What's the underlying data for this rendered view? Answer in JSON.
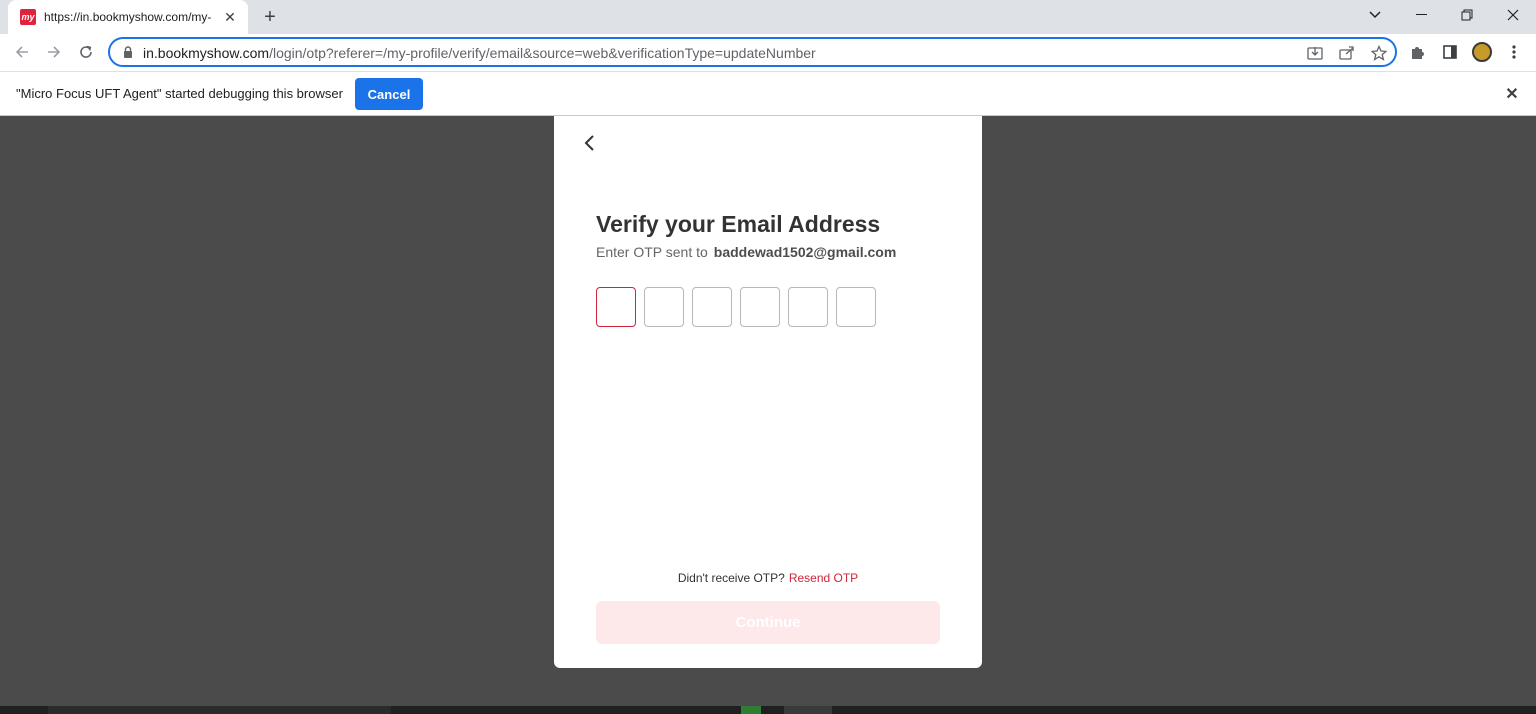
{
  "browser": {
    "tab_title": "https://in.bookmyshow.com/my-",
    "favicon_text": "my",
    "url_host": "in.bookmyshow.com",
    "url_path": "/login/otp?referer=/my-profile/verify/email&source=web&verificationType=updateNumber"
  },
  "infobar": {
    "message": "\"Micro Focus UFT Agent\" started debugging this browser",
    "cancel_label": "Cancel"
  },
  "modal": {
    "title": "Verify your Email Address",
    "subtitle": "Enter OTP sent to",
    "email": "baddewad1502@gmail.com",
    "otp_digits": [
      "",
      "",
      "",
      "",
      "",
      ""
    ],
    "resend_prompt": "Didn't receive OTP?",
    "resend_label": "Resend OTP",
    "continue_label": "Continue"
  },
  "colors": {
    "accent": "#d0253b",
    "button_disabled": "#fde8ea",
    "chrome_blue": "#1a73e8",
    "overlay": "#4b4b4b"
  }
}
